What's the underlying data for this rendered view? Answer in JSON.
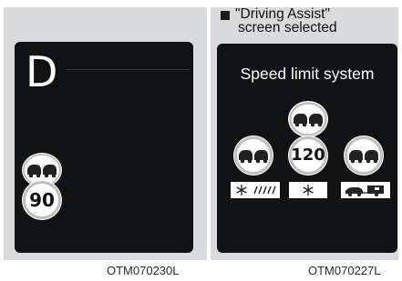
{
  "left_panel": {
    "gear": "D",
    "speed_limit": "90",
    "code": "OTM070230L"
  },
  "right_panel": {
    "note": "\"Driving Assist\" screen selected",
    "note_line1": "\"Driving Assist\"",
    "note_line2": "screen selected",
    "screen_title": "Speed limit system",
    "speed_limit": "120",
    "code": "OTM070227L",
    "conditions": [
      "rain-snowflake-icon",
      "snowflake-icon",
      "car-trailer-icon"
    ]
  }
}
